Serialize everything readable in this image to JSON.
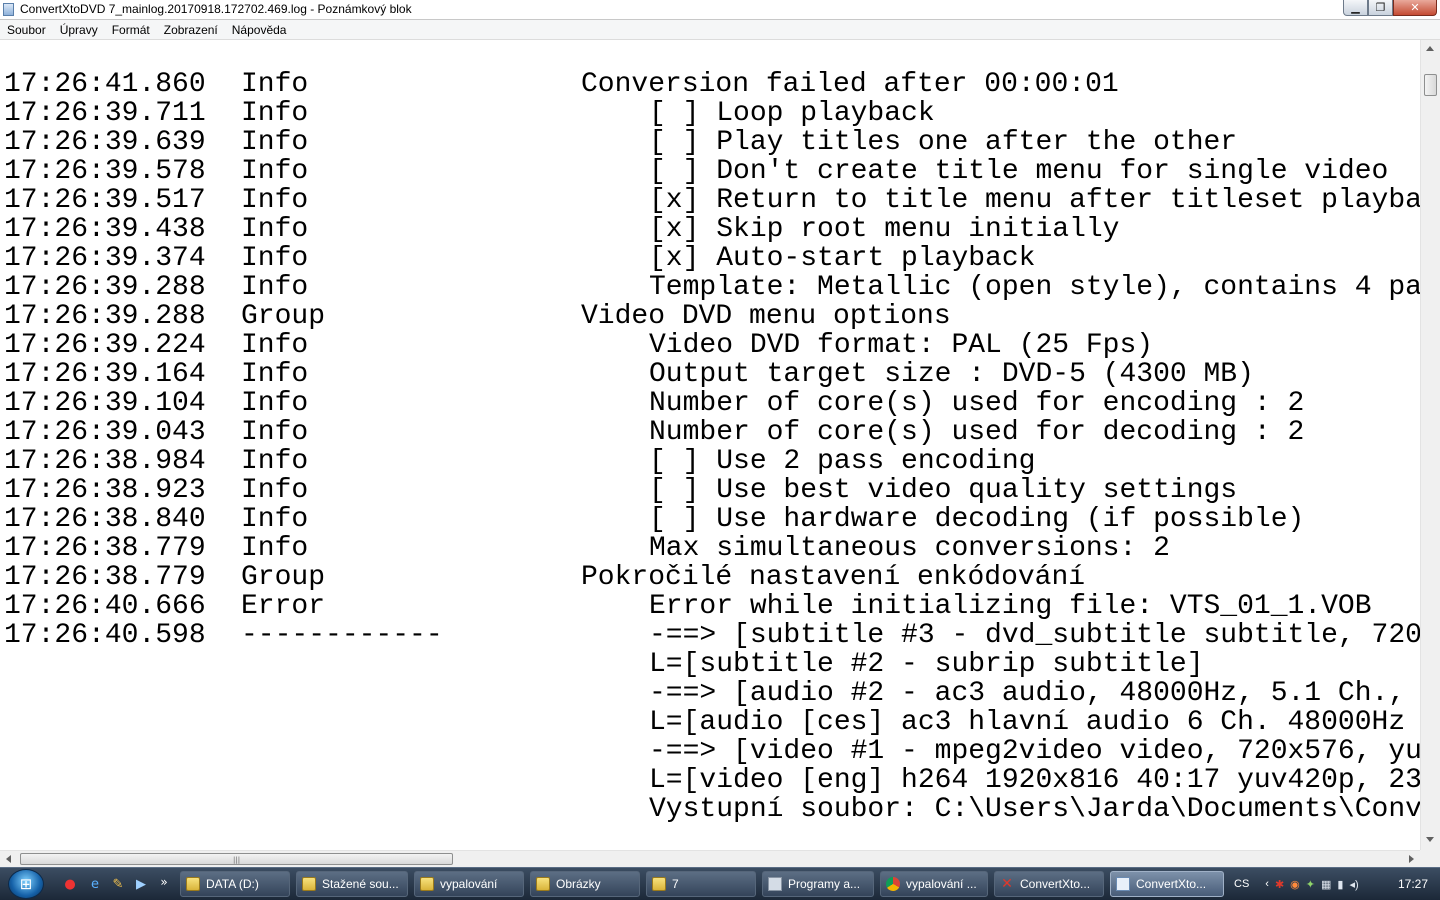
{
  "window": {
    "title": "ConvertXtoDVD 7_mainlog.20170918.172702.469.log - Poznámkový blok",
    "minimize_glyph": "▁",
    "maximize_glyph": "❐",
    "close_glyph": "✕"
  },
  "menu": [
    "Soubor",
    "Úpravy",
    "Formát",
    "Zobrazení",
    "Nápověda"
  ],
  "log_lines": [
    {
      "time": "17:26:41.860",
      "level": "Info",
      "indent": 0,
      "text": "Conversion failed after 00:00:01"
    },
    {
      "time": "17:26:39.711",
      "level": "Info",
      "indent": 1,
      "text": "[ ] Loop playback"
    },
    {
      "time": "17:26:39.639",
      "level": "Info",
      "indent": 1,
      "text": "[ ] Play titles one after the other"
    },
    {
      "time": "17:26:39.578",
      "level": "Info",
      "indent": 1,
      "text": "[ ] Don't create title menu for single video"
    },
    {
      "time": "17:26:39.517",
      "level": "Info",
      "indent": 1,
      "text": "[x] Return to title menu after titleset playba"
    },
    {
      "time": "17:26:39.438",
      "level": "Info",
      "indent": 1,
      "text": "[x] Skip root menu initially"
    },
    {
      "time": "17:26:39.374",
      "level": "Info",
      "indent": 1,
      "text": "[x] Auto-start playback"
    },
    {
      "time": "17:26:39.288",
      "level": "Info",
      "indent": 1,
      "text": "Template: Metallic (open style), contains 4 pa"
    },
    {
      "time": "17:26:39.288",
      "level": "Group",
      "indent": 0,
      "text": "Video DVD menu options"
    },
    {
      "time": "17:26:39.224",
      "level": "Info",
      "indent": 1,
      "text": "Video DVD format: PAL (25 Fps)"
    },
    {
      "time": "17:26:39.164",
      "level": "Info",
      "indent": 1,
      "text": "Output target size : DVD-5 (4300 MB)"
    },
    {
      "time": "17:26:39.104",
      "level": "Info",
      "indent": 1,
      "text": "Number of core(s) used for encoding : 2"
    },
    {
      "time": "17:26:39.043",
      "level": "Info",
      "indent": 1,
      "text": "Number of core(s) used for decoding : 2"
    },
    {
      "time": "17:26:38.984",
      "level": "Info",
      "indent": 1,
      "text": "[ ] Use 2 pass encoding"
    },
    {
      "time": "17:26:38.923",
      "level": "Info",
      "indent": 1,
      "text": "[ ] Use best video quality settings"
    },
    {
      "time": "17:26:38.840",
      "level": "Info",
      "indent": 1,
      "text": "[ ] Use hardware decoding (if possible)"
    },
    {
      "time": "17:26:38.779",
      "level": "Info",
      "indent": 1,
      "text": "Max simultaneous conversions: 2"
    },
    {
      "time": "17:26:38.779",
      "level": "Group",
      "indent": 0,
      "text": "Pokročilé nastavení enkódování"
    },
    {
      "time": "17:26:40.666",
      "level": "Error",
      "indent": 1,
      "text": "Error while initializing file: VTS_01_1.VOB"
    },
    {
      "time": "17:26:40.598",
      "level": "------------",
      "indent": 1,
      "text": "-==> [subtitle #3 - dvd_subtitle subtitle, 720"
    },
    {
      "time": "",
      "level": "",
      "indent": 1,
      "text": "L=[subtitle #2 - subrip subtitle]"
    },
    {
      "time": "",
      "level": "",
      "indent": 1,
      "text": "-==> [audio #2 - ac3 audio, 48000Hz, 5.1 Ch.,"
    },
    {
      "time": "",
      "level": "",
      "indent": 1,
      "text": "L=[audio [ces] ac3 hlavní audio 6 Ch. 48000Hz"
    },
    {
      "time": "",
      "level": "",
      "indent": 1,
      "text": "-==> [video #1 - mpeg2video video, 720x576, yu"
    },
    {
      "time": "",
      "level": "",
      "indent": 1,
      "text": "L=[video [eng] h264 1920x816 40:17 yuv420p, 23"
    },
    {
      "time": "",
      "level": "",
      "indent": 1,
      "text": "Vystupní soubor: C:\\Users\\Jarda\\Documents\\Conv"
    }
  ],
  "hscroll_grip": "|||",
  "taskbar": {
    "chevron": "»",
    "buttons": [
      {
        "label": "DATA (D:)",
        "icon": "folder-icon",
        "active": false
      },
      {
        "label": "Stažené sou...",
        "icon": "folder-icon",
        "active": false
      },
      {
        "label": "vypalování",
        "icon": "folder-icon",
        "active": false
      },
      {
        "label": "Obrázky",
        "icon": "folder-icon",
        "active": false
      },
      {
        "label": "7",
        "icon": "folder-icon",
        "active": false
      },
      {
        "label": "Programy a...",
        "icon": "programs-icon",
        "active": false
      },
      {
        "label": "vypalování ...",
        "icon": "chrome-icon",
        "active": false
      },
      {
        "label": "ConvertXto...",
        "icon": "convertx-icon",
        "active": false
      },
      {
        "label": "ConvertXto...",
        "icon": "notepad-icon",
        "active": true
      }
    ],
    "language": "CS",
    "time": "17:27"
  }
}
